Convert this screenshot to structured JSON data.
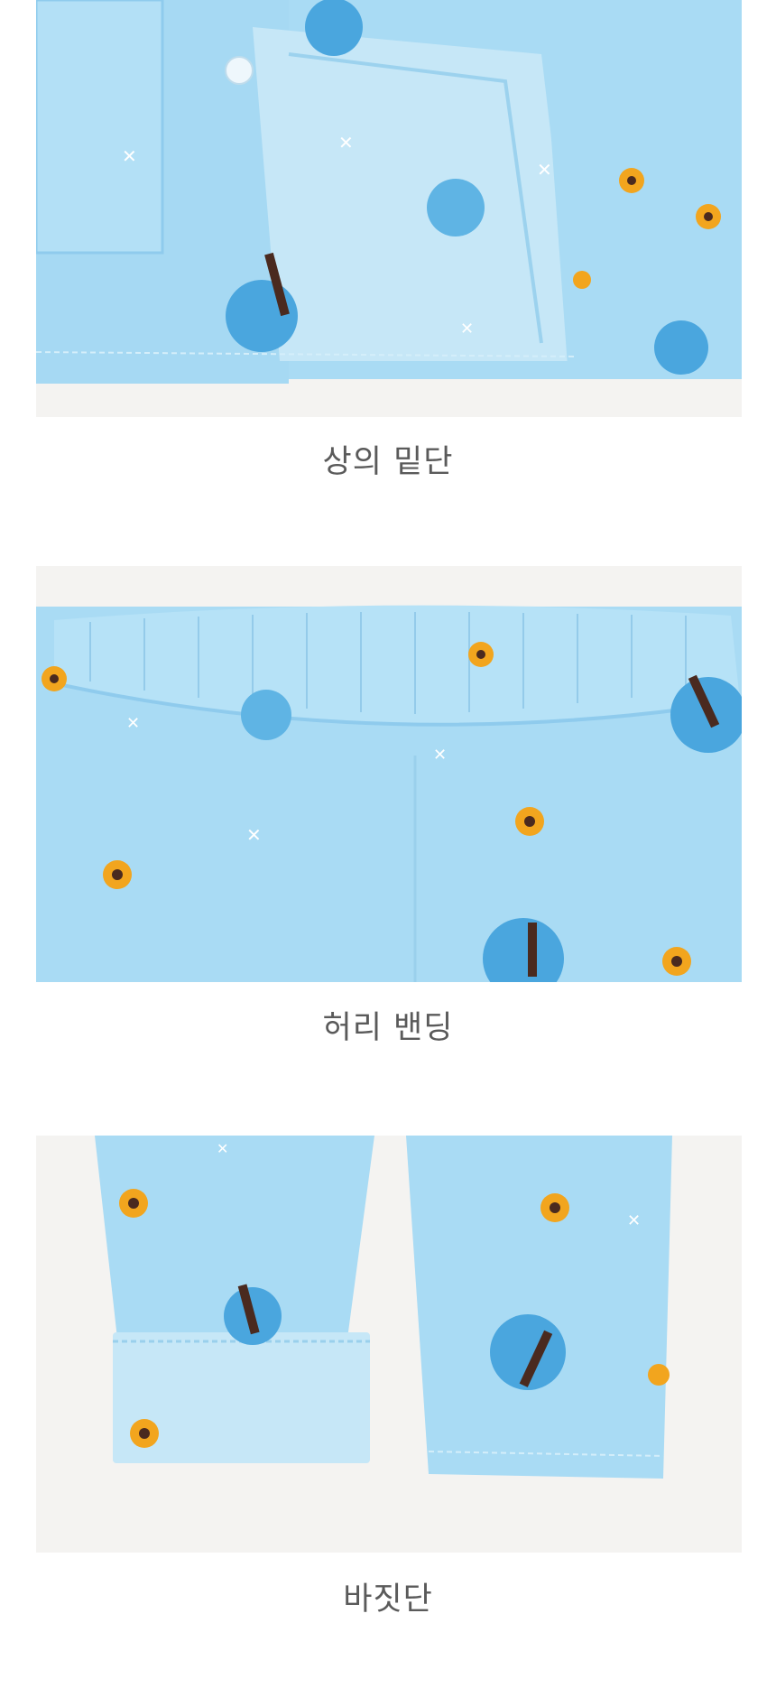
{
  "sections": [
    {
      "caption": "상의 밑단"
    },
    {
      "caption": "허리 밴딩"
    },
    {
      "caption": "바짓단"
    }
  ],
  "colors": {
    "fabric": "#a9dbf4",
    "fabric_dark": "#8fcbed",
    "lining": "#c6e7f7",
    "backdrop": "#f4f3f1",
    "caption_text": "#5a5a5a",
    "tree": "#4aa6de",
    "trunk": "#4a2a1f",
    "flower": "#f2a51e"
  },
  "images": [
    {
      "name": "top-hem-photo",
      "icon": "pajama-top-hem"
    },
    {
      "name": "waistband-photo",
      "icon": "pajama-waistband"
    },
    {
      "name": "pant-hem-photo",
      "icon": "pajama-pant-hem"
    }
  ]
}
